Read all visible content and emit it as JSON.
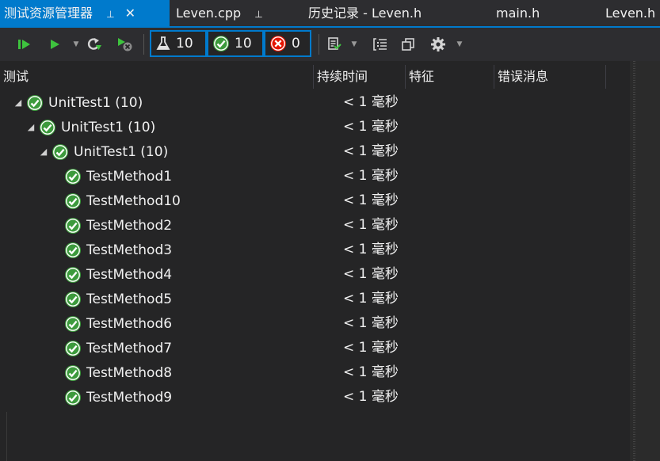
{
  "tabs": [
    {
      "label": "测试资源管理器",
      "pin": "⊥",
      "close": "✕"
    },
    {
      "label": "Leven.cpp",
      "pin": "⊥"
    },
    {
      "label": "历史记录 - Leven.h"
    },
    {
      "label": "main.h"
    },
    {
      "label": "Leven.h"
    }
  ],
  "toolbar": {
    "total_count": "10",
    "passed_count": "10",
    "failed_count": "0"
  },
  "columns": {
    "test": "测试",
    "duration": "持续时间",
    "traits": "特征",
    "error": "错误消息"
  },
  "tree": [
    {
      "label": "UnitTest1 (10)",
      "duration": "< 1 毫秒",
      "status": "passed",
      "expanded": true
    },
    {
      "label": "UnitTest1 (10)",
      "duration": "< 1 毫秒",
      "status": "passed",
      "expanded": true
    },
    {
      "label": "UnitTest1 (10)",
      "duration": "< 1 毫秒",
      "status": "passed",
      "expanded": true
    },
    {
      "label": "TestMethod1",
      "duration": "< 1 毫秒",
      "status": "passed"
    },
    {
      "label": "TestMethod10",
      "duration": "< 1 毫秒",
      "status": "passed"
    },
    {
      "label": "TestMethod2",
      "duration": "< 1 毫秒",
      "status": "passed"
    },
    {
      "label": "TestMethod3",
      "duration": "< 1 毫秒",
      "status": "passed"
    },
    {
      "label": "TestMethod4",
      "duration": "< 1 毫秒",
      "status": "passed"
    },
    {
      "label": "TestMethod5",
      "duration": "< 1 毫秒",
      "status": "passed"
    },
    {
      "label": "TestMethod6",
      "duration": "< 1 毫秒",
      "status": "passed"
    },
    {
      "label": "TestMethod7",
      "duration": "< 1 毫秒",
      "status": "passed"
    },
    {
      "label": "TestMethod8",
      "duration": "< 1 毫秒",
      "status": "passed"
    },
    {
      "label": "TestMethod9",
      "duration": "< 1 毫秒",
      "status": "passed"
    }
  ],
  "colors": {
    "accent": "#007acc",
    "pass": "#3c9a3c",
    "fail": "#e51400",
    "background": "#252526"
  },
  "icons": [
    "run-all-icon",
    "run-icon",
    "refresh-icon",
    "cancel-icon",
    "flask-icon",
    "passed-icon",
    "failed-icon",
    "playlist-icon",
    "group-by-icon",
    "copy-icon",
    "settings-icon",
    "expand-icon",
    "passed-check-icon"
  ]
}
